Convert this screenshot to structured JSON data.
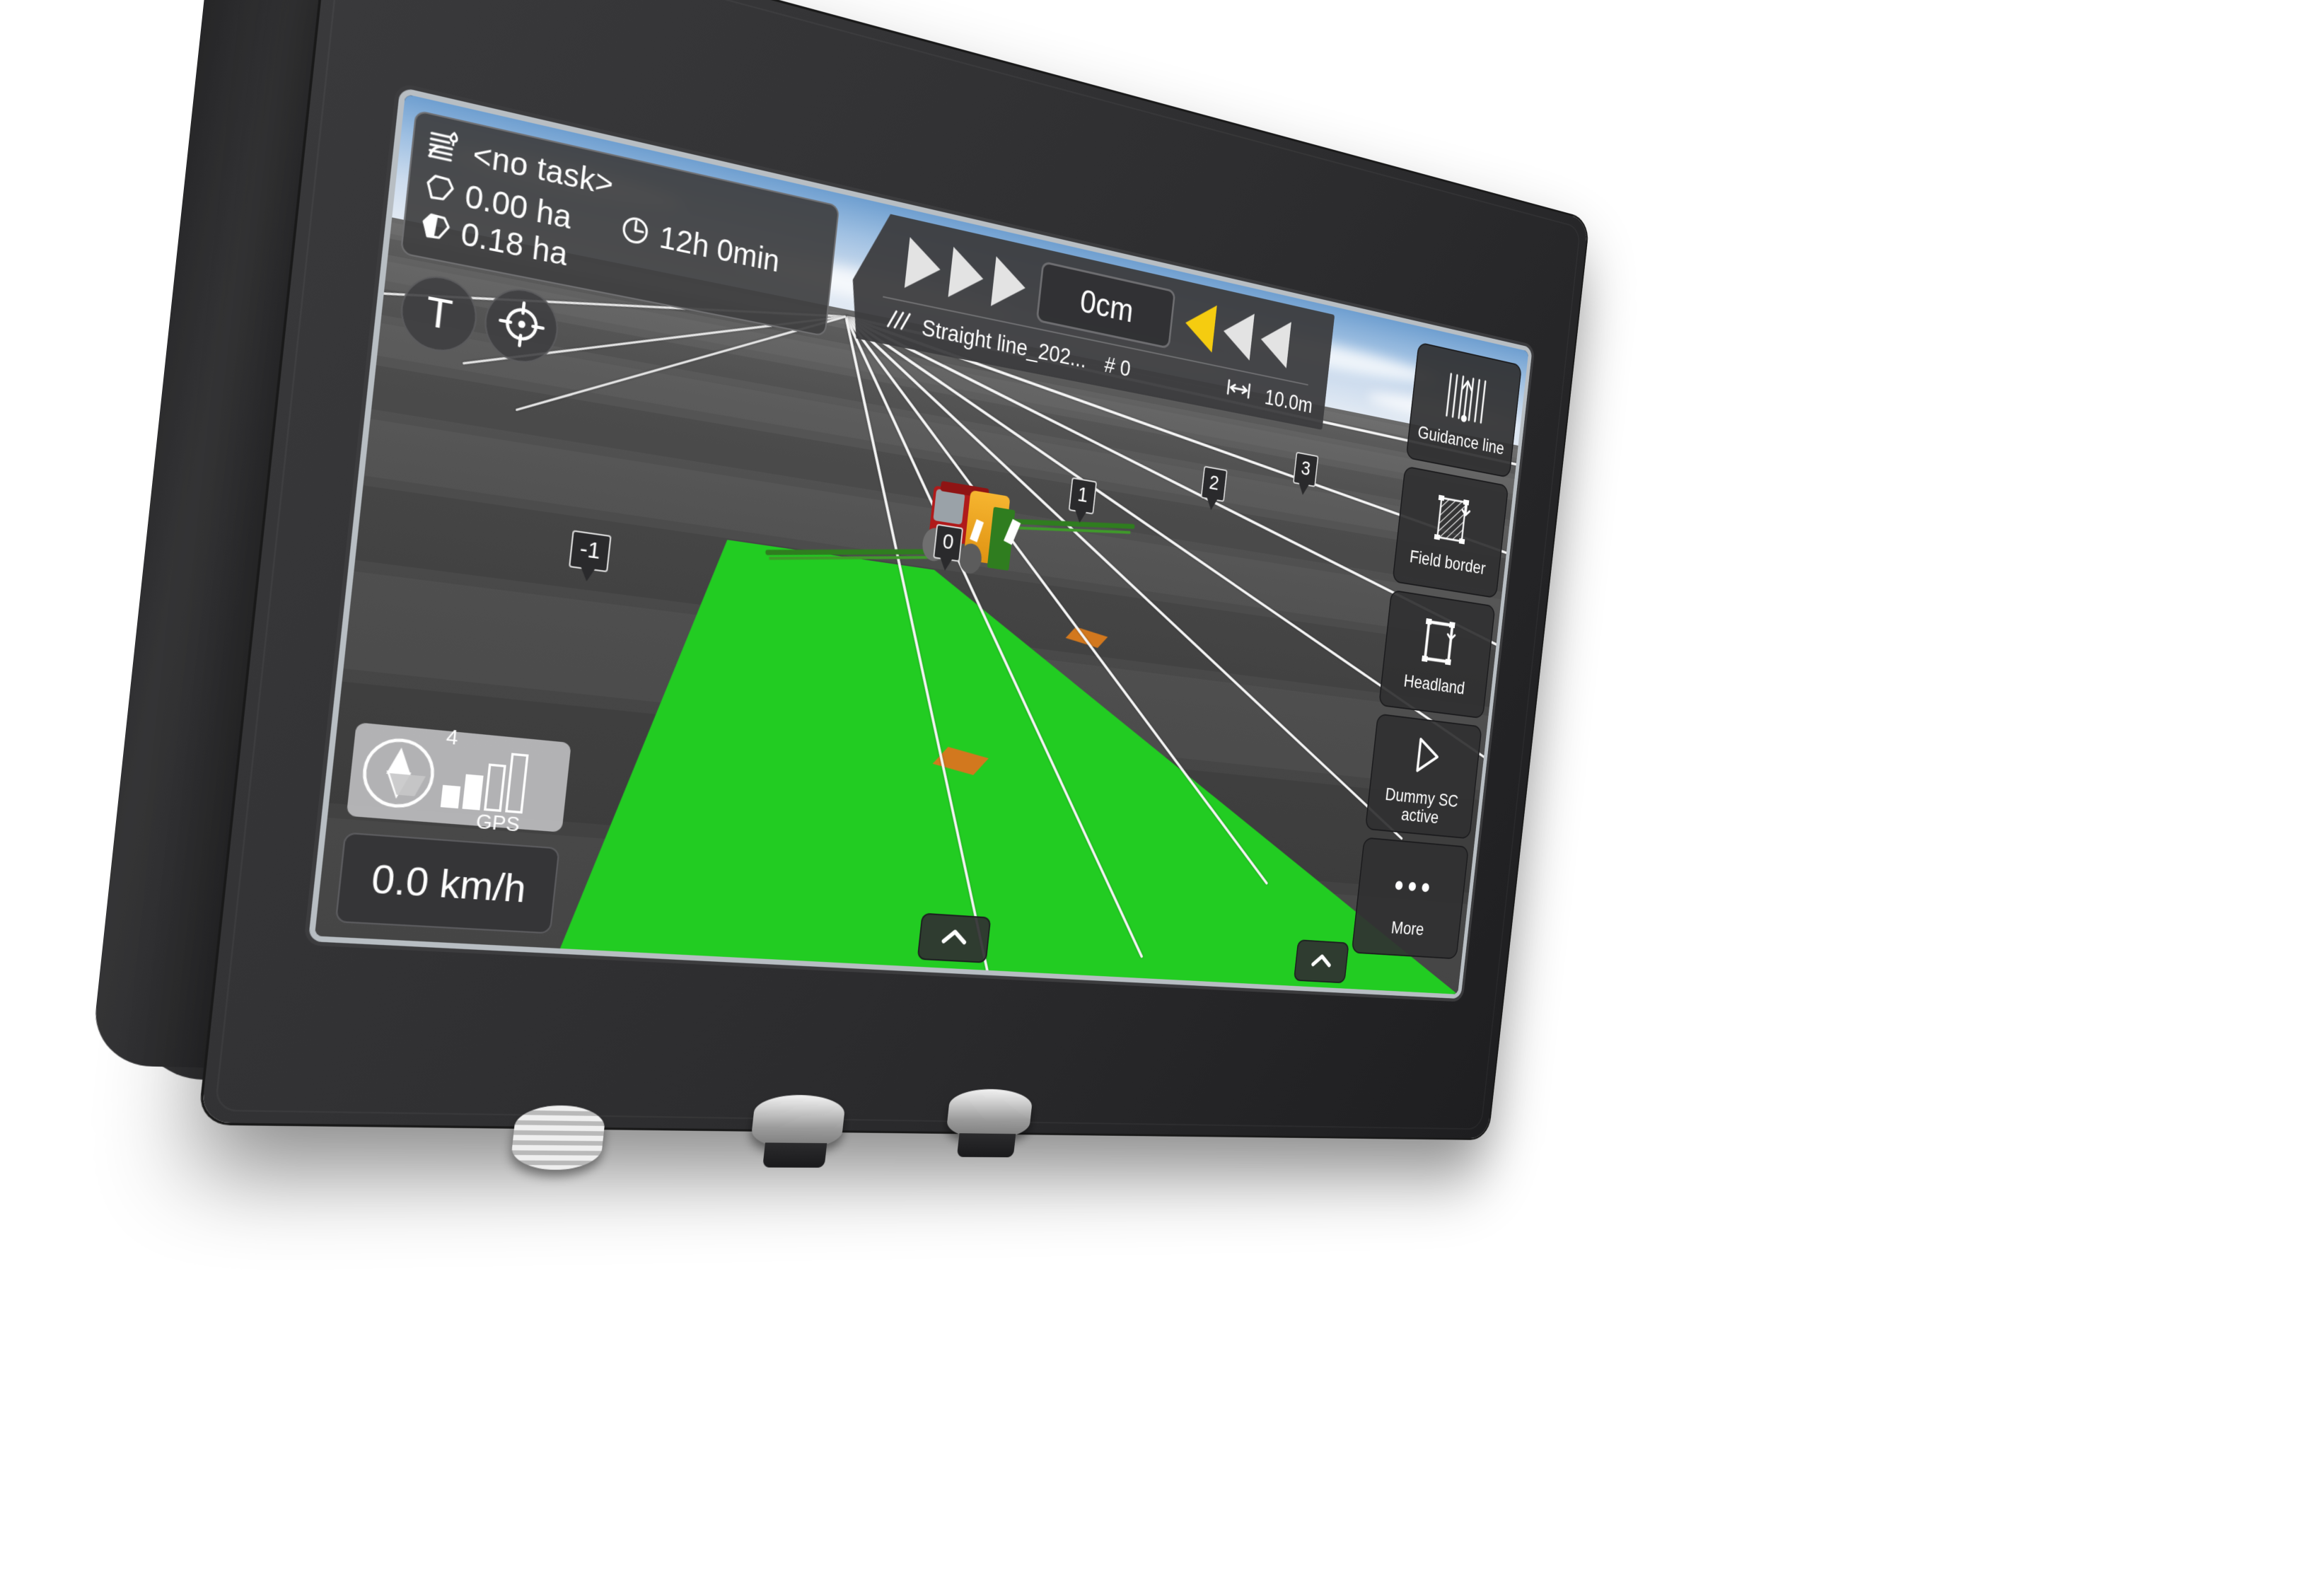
{
  "device": {
    "type": "agricultural-gps-guidance-terminal",
    "bezel_color": "#2c2c2e",
    "connector_count": 3
  },
  "screen": {
    "sky_color_top": "#6f9fd0",
    "ground_color": "#4d4d4d",
    "worked_area_color": "#22cc22",
    "section_marker_color": "#d2781e",
    "guideline_color": "#f4f4f4"
  },
  "task_panel": {
    "task_icon": "field-task-icon",
    "task_name": "<no task>",
    "area_icon": "field-outline-icon",
    "area_value": "0.00 ha",
    "time_icon": "clock-icon",
    "time_value": "12h 0min",
    "worked_icon": "field-filled-icon",
    "worked_value": "0.18 ha"
  },
  "lightbar": {
    "right_arrows": 3,
    "left_arrows": 3,
    "active_left_index": 0,
    "active_color": "#f5cc10",
    "inactive_color": "#e3e3e3",
    "deviation": "0cm",
    "line_icon": "guidance-lines-icon",
    "line_name": "Straight line_202...",
    "line_number": "# 0",
    "width_icon": "width-measure-icon",
    "width_value": "10.0m"
  },
  "map_buttons": [
    {
      "name": "terrain-toggle-button",
      "glyph": "T"
    },
    {
      "name": "recenter-target-button",
      "glyph": "crosshair-icon"
    }
  ],
  "sidebar": {
    "items": [
      {
        "name": "guidance-line-button",
        "icon": "guidance-line-icon",
        "label": "Guidance line"
      },
      {
        "name": "field-border-button",
        "icon": "field-border-icon",
        "label": "Field border"
      },
      {
        "name": "headland-button",
        "icon": "headland-icon",
        "label": "Headland"
      },
      {
        "name": "section-control-button",
        "icon": "play-triangle-icon",
        "label": "Dummy SC active"
      },
      {
        "name": "more-button",
        "icon": "ellipsis-icon",
        "label": "More"
      }
    ]
  },
  "gps": {
    "compass_icon": "compass-needle-icon",
    "satellites": "4",
    "signal_bars_total": 4,
    "signal_bars_filled": 2,
    "label": "GPS"
  },
  "speed": {
    "value": "0.0 km/h"
  },
  "expand_buttons": [
    {
      "name": "expand-bottom-center-button",
      "icon": "chevron-up-icon"
    },
    {
      "name": "expand-bottom-right-button",
      "icon": "chevron-up-icon"
    }
  ],
  "track_markers": [
    {
      "label": "-1"
    },
    {
      "label": "0"
    },
    {
      "label": "1"
    },
    {
      "label": "2"
    },
    {
      "label": "3"
    }
  ],
  "vehicle": {
    "name": "self-propelled-sprayer",
    "cab_color": "#b01a1a",
    "tank_color": "#f0a51e",
    "boom_color": "#2f7d1f"
  }
}
